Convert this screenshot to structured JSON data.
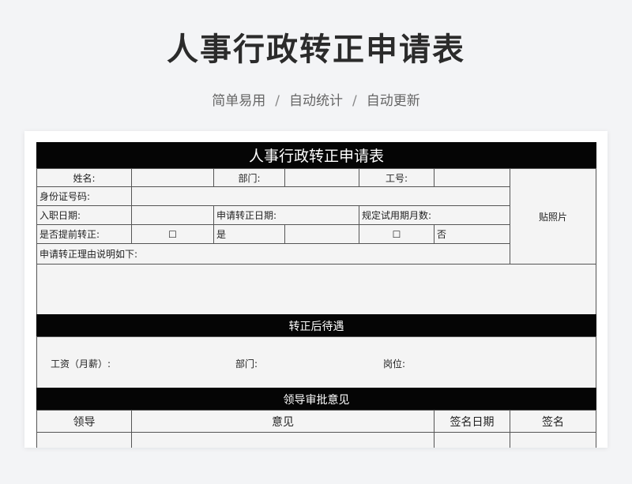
{
  "page": {
    "title": "人事行政转正申请表",
    "subtitle": [
      "简单易用",
      "自动统计",
      "自动更新"
    ],
    "separator": "/"
  },
  "form": {
    "header": "人事行政转正申请表",
    "name_label": "姓名:",
    "dept_label": "部门:",
    "id_label": "工号:",
    "photo_label": "贴照片",
    "idcard_label": "身份证号码:",
    "hire_date_label": "入职日期:",
    "apply_date_label": "申请转正日期:",
    "probation_label": "规定试用期月数:",
    "early_label": "是否提前转正:",
    "checkbox_symbol": "☐",
    "yes_label": "是",
    "no_label": "否",
    "reason_label": "申请转正理由说明如下:",
    "treatment_header": "转正后待遇",
    "salary_label": "工资（月薪）:",
    "new_dept_label": "部门:",
    "position_label": "岗位:",
    "review_header": "领导审批意见",
    "review_columns": [
      "领导",
      "意见",
      "签名日期",
      "签名"
    ]
  }
}
